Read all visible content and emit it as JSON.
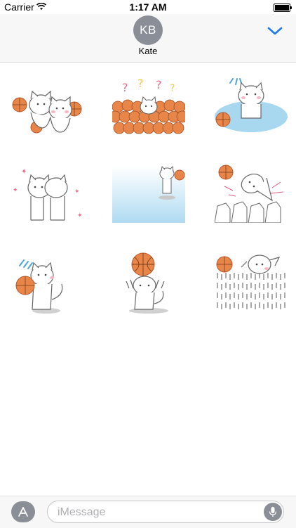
{
  "status_bar": {
    "carrier": "Carrier",
    "time": "1:17 AM"
  },
  "header": {
    "avatar_initials": "KB",
    "contact_name": "Kate",
    "expand_icon": "chevron-down-icon"
  },
  "sticker_grid": {
    "stickers": [
      "cats-hugging-basketballs",
      "cat-in-ball-pit-confused",
      "cat-sitting-puddle",
      "cats-hugging-sparkles",
      "cat-holding-ball-gradient",
      "cat-jumping-crowd",
      "cat-sweating-with-ball",
      "cat-balancing-ball",
      "cat-crowd-surfing"
    ]
  },
  "input_bar": {
    "placeholder": "iMessage",
    "apps_icon": "app-store-icon",
    "mic_icon": "microphone-icon"
  },
  "colors": {
    "accent": "#1f7aed",
    "ball": "#e8864a",
    "ball_dark": "#b8582a",
    "water": "#a8d8f0",
    "gray": "#8a8e96"
  }
}
